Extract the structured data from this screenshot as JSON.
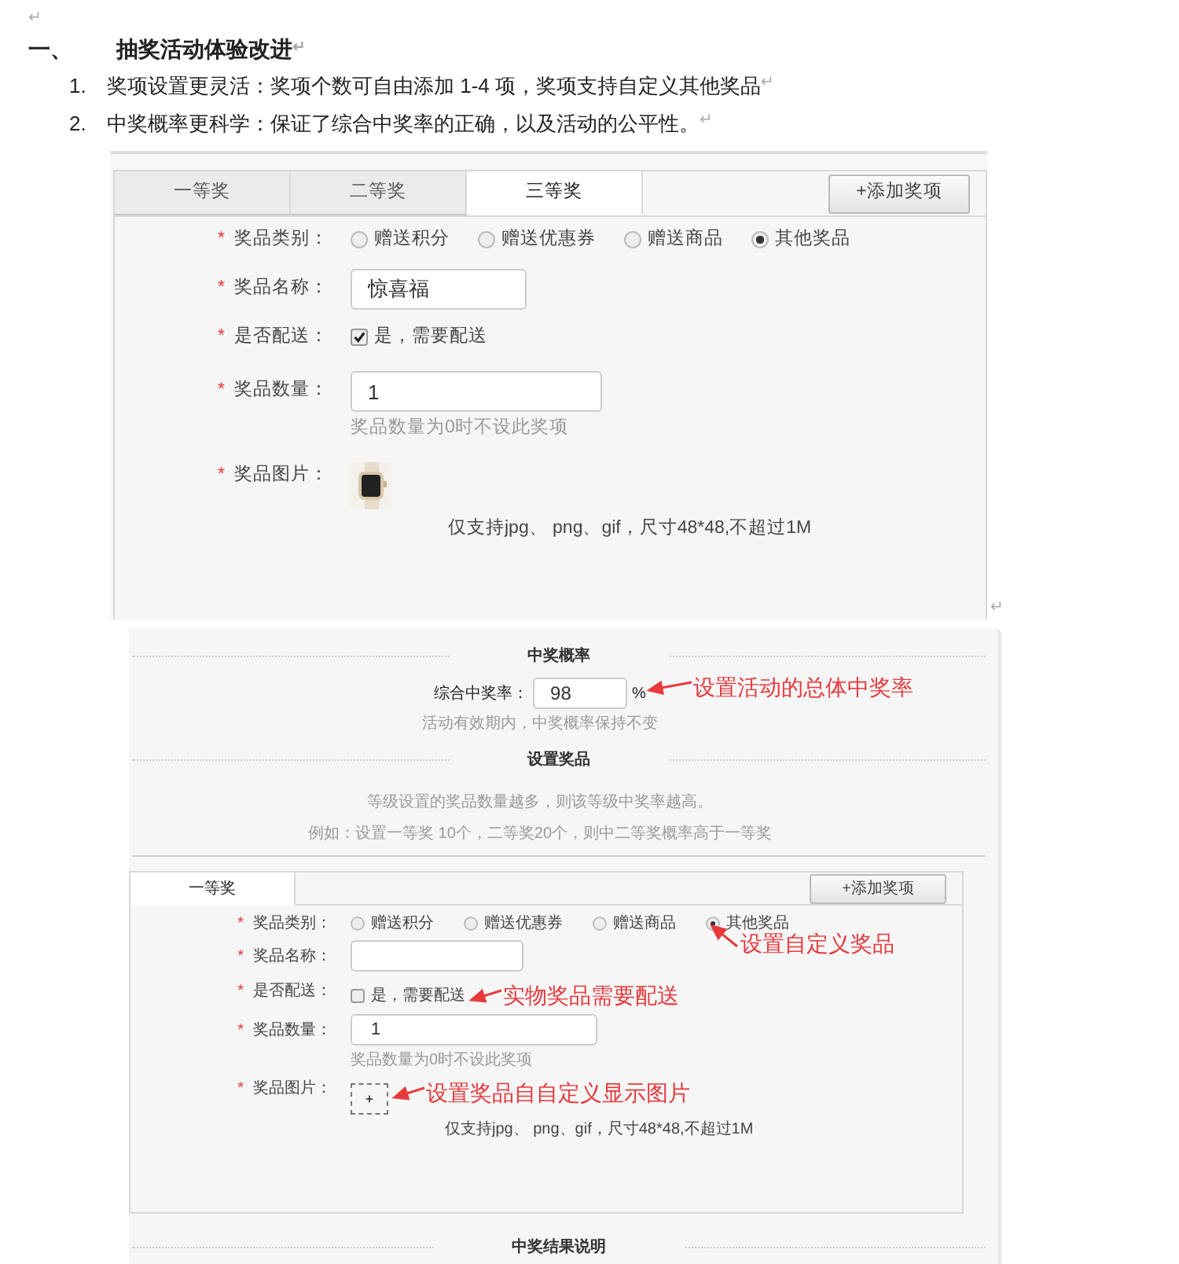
{
  "document": {
    "blank_mark": "↵",
    "heading": {
      "number": "一、",
      "title": "抽奖活动体验改进",
      "mark": "↵"
    },
    "items": [
      {
        "number": "1.",
        "text": "奖项设置更灵活：奖项个数可自由添加 1-4 项，奖项支持自定义其他奖品",
        "mark": "↵"
      },
      {
        "number": "2.",
        "text": "中奖概率更科学：保证了综合中奖率的正确，以及活动的公平性。",
        "mark": "↵"
      }
    ]
  },
  "form_screenshot": {
    "mark": "↵",
    "panel": {
      "tabs": [
        {
          "label": "一等奖",
          "selected": false
        },
        {
          "label": "二等奖",
          "selected": false
        },
        {
          "label": "三等奖",
          "selected": true
        }
      ],
      "add_button": "+添加奖项",
      "fields": [
        {
          "kind": "radio",
          "star": "*",
          "label": "奖品类别：",
          "options": [
            {
              "label": "赠送积分",
              "selected": false
            },
            {
              "label": "赠送优惠券",
              "selected": false
            },
            {
              "label": "赠送商品",
              "selected": false
            },
            {
              "label": "其他奖品",
              "selected": true
            }
          ]
        },
        {
          "kind": "text",
          "star": "*",
          "label": "奖品名称：",
          "value": "惊喜福"
        },
        {
          "kind": "checkbox",
          "star": "*",
          "label": "是否配送：",
          "checked": true,
          "text": "是，需要配送"
        },
        {
          "kind": "number",
          "star": "*",
          "label": "奖品数量：",
          "value": "1",
          "hint": "奖品数量为0时不设此奖项"
        },
        {
          "star": "*",
          "label": "奖品图片：",
          "note": "仅支持jpg、 png、gif，尺寸48*48,不超过1M"
        }
      ]
    }
  },
  "settings_screenshot": {
    "probability": {
      "title": "中奖概率",
      "label": "综合中奖率：",
      "value": "98",
      "unit": "%",
      "annotation": "设置活动的总体中奖率",
      "hint": "活动有效期内，中奖概率保持不变"
    },
    "prize_settings": {
      "title": "设置奖品",
      "notes": [
        "等级设置的奖品数量越多，则该等级中奖率越高。",
        "例如：设置一等奖 10个，二等奖20个，则中二等奖概率高于一等奖"
      ]
    },
    "panel": {
      "tabs": [
        {
          "label": "一等奖",
          "selected": true
        }
      ],
      "add_button": "+添加奖项",
      "fields": [
        {
          "kind": "radio",
          "star": "*",
          "label": "奖品类别：",
          "options": [
            {
              "label": "赠送积分",
              "selected": false
            },
            {
              "label": "赠送优惠券",
              "selected": false
            },
            {
              "label": "赠送商品",
              "selected": false
            },
            {
              "label": "其他奖品",
              "selected": true
            }
          ],
          "annotation": "设置自定义奖品"
        },
        {
          "kind": "text",
          "star": "*",
          "label": "奖品名称："
        },
        {
          "kind": "checkbox",
          "star": "*",
          "label": "是否配送：",
          "checked": false,
          "text": "是，需要配送",
          "annotation": "实物奖品需要配送"
        },
        {
          "kind": "number",
          "star": "*",
          "label": "奖品数量：",
          "value": "1",
          "hint": "奖品数量为0时不设此奖项"
        },
        {
          "kind": "upload",
          "star": "*",
          "label": "奖品图片：",
          "button": "+",
          "annotation": "设置奖品自自定义显示图片",
          "note": "仅支持jpg、 png、gif，尺寸48*48,不超过1M"
        }
      ]
    },
    "result_section": {
      "title": "中奖结果说明"
    }
  }
}
